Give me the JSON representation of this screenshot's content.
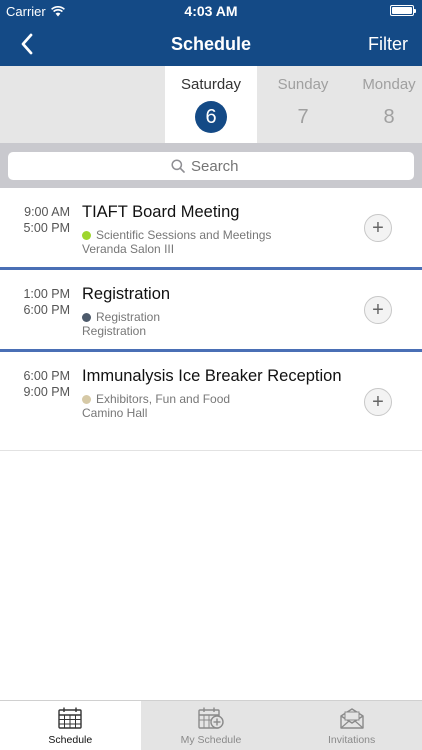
{
  "status": {
    "carrier": "Carrier",
    "time": "4:03 AM"
  },
  "nav": {
    "title": "Schedule",
    "filter_label": "Filter"
  },
  "days": [
    {
      "name": "Saturday",
      "number": "6",
      "selected": true
    },
    {
      "name": "Sunday",
      "number": "7",
      "selected": false
    },
    {
      "name": "Monday",
      "number": "8",
      "selected": false
    }
  ],
  "search": {
    "placeholder": "Search"
  },
  "sessions": [
    {
      "start": "9:00 AM",
      "end": "5:00 PM",
      "title": "TIAFT Board Meeting",
      "track": "Scientific Sessions and Meetings",
      "track_color": "#9ed62e",
      "location": "Veranda Salon III"
    },
    {
      "start": "1:00 PM",
      "end": "6:00 PM",
      "title": "Registration",
      "track": "Registration",
      "track_color": "#4d5a6b",
      "location": "Registration"
    },
    {
      "start": "6:00 PM",
      "end": "9:00 PM",
      "title": "Immunalysis Ice Breaker Reception",
      "track": "Exhibitors, Fun and Food",
      "track_color": "#d6c9a6",
      "location": "Camino Hall"
    }
  ],
  "tabs": [
    {
      "label": "Schedule",
      "icon": "calendar-icon",
      "active": true
    },
    {
      "label": "My Schedule",
      "icon": "calendar-add-icon",
      "active": false
    },
    {
      "label": "Invitations",
      "icon": "envelope-icon",
      "active": false
    }
  ],
  "colors": {
    "brand": "#144a86",
    "separator": "#4a6fb5"
  }
}
